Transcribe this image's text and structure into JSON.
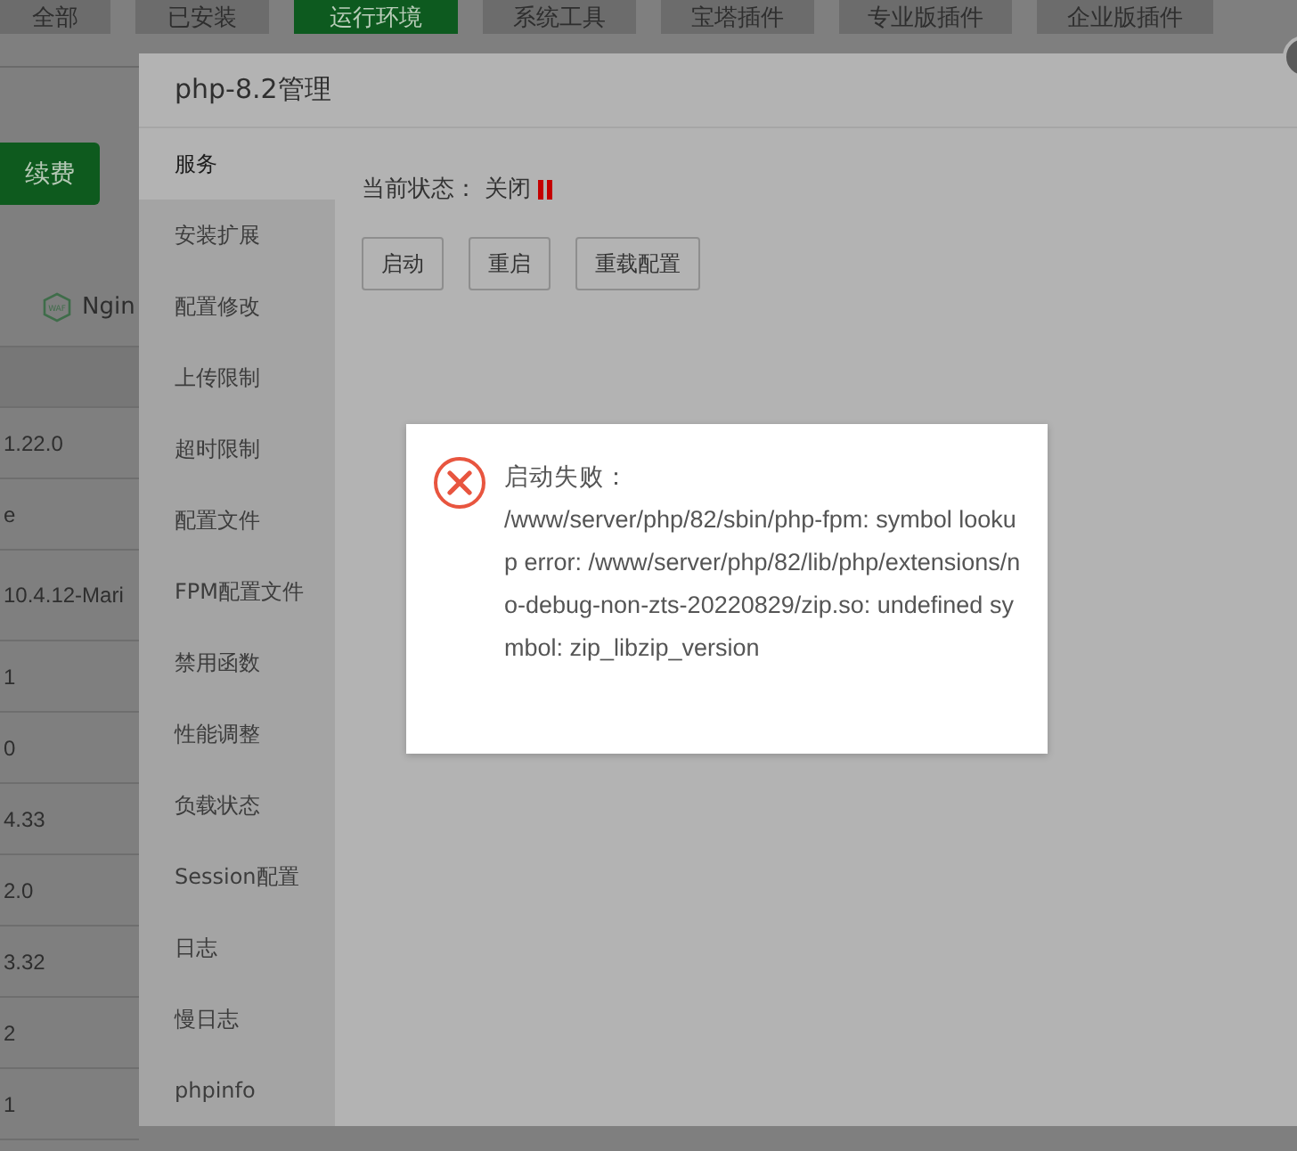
{
  "top_tabs": [
    {
      "label": "全部",
      "selected": false
    },
    {
      "label": "已安装",
      "selected": false
    },
    {
      "label": "运行环境",
      "selected": true
    },
    {
      "label": "系统工具",
      "selected": false
    },
    {
      "label": "宝塔插件",
      "selected": false
    },
    {
      "label": "专业版插件",
      "selected": false
    },
    {
      "label": "企业版插件",
      "selected": false
    }
  ],
  "renew_button": "续费",
  "plugin": {
    "badge": "WAF",
    "name": "Ngin"
  },
  "versions": [
    "1.22.0",
    "e",
    "10.4.12-Mari",
    "1",
    "0",
    "4.33",
    "2.0",
    "3.32",
    "2",
    "1"
  ],
  "dialog": {
    "title": "php-8.2管理",
    "nav": [
      {
        "label": "服务",
        "selected": true
      },
      {
        "label": "安装扩展",
        "selected": false
      },
      {
        "label": "配置修改",
        "selected": false
      },
      {
        "label": "上传限制",
        "selected": false
      },
      {
        "label": "超时限制",
        "selected": false
      },
      {
        "label": "配置文件",
        "selected": false
      },
      {
        "label": "FPM配置文件",
        "selected": false
      },
      {
        "label": "禁用函数",
        "selected": false
      },
      {
        "label": "性能调整",
        "selected": false
      },
      {
        "label": "负载状态",
        "selected": false
      },
      {
        "label": "Session配置",
        "selected": false
      },
      {
        "label": "日志",
        "selected": false
      },
      {
        "label": "慢日志",
        "selected": false
      },
      {
        "label": "phpinfo",
        "selected": false
      }
    ],
    "status_label": "当前状态：",
    "status_value": "关闭",
    "running": false,
    "buttons": [
      "启动",
      "重启",
      "重载配置"
    ]
  },
  "toast": {
    "kind": "error",
    "title": "启动失败：",
    "message": "/www/server/php/82/sbin/php-fpm: symbol lookup error: /www/server/php/82/lib/php/extensions/no-debug-non-zts-20220829/zip.so: undefined symbol: zip_libzip_version"
  }
}
